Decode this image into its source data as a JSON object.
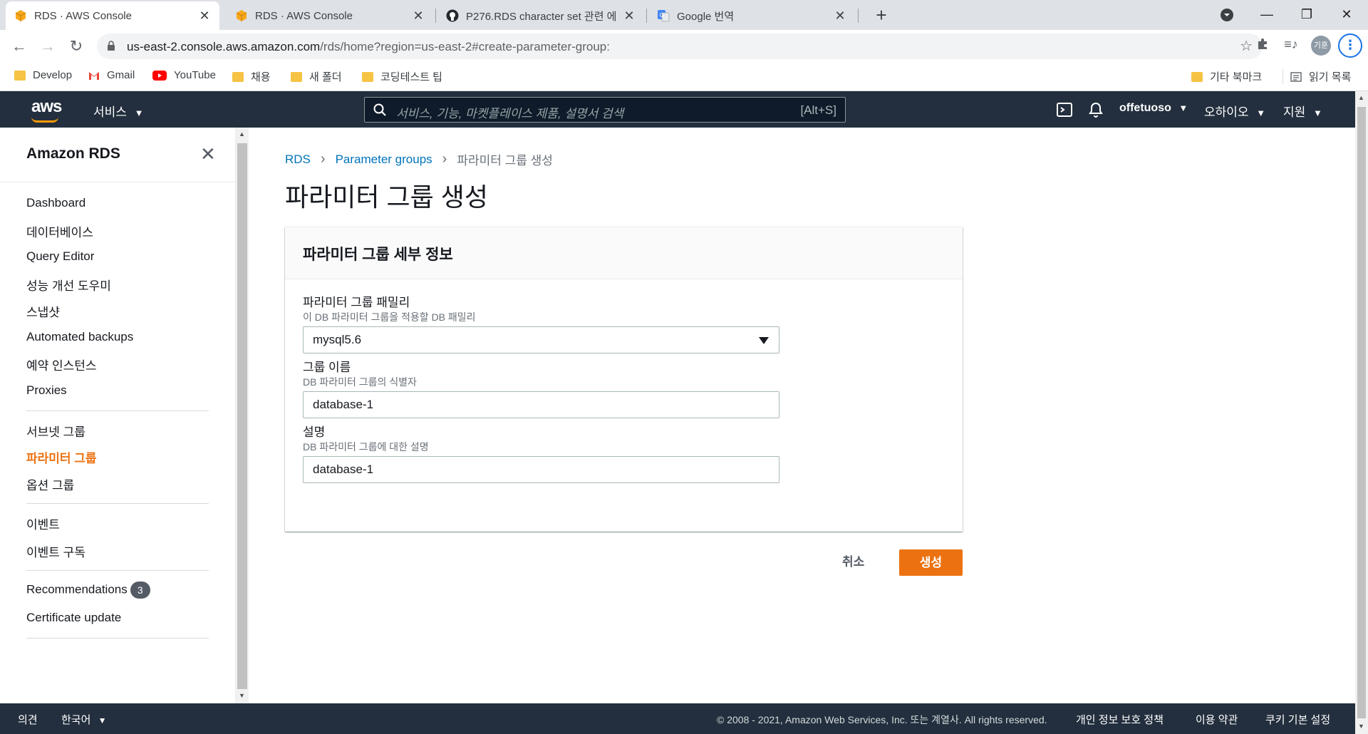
{
  "browser": {
    "tabs": [
      {
        "title": "RDS · AWS Console",
        "active": true,
        "icon": "aws-box-icon"
      },
      {
        "title": "RDS · AWS Console",
        "active": false,
        "icon": "aws-box-icon"
      },
      {
        "title": "P276.RDS character set 관련 에",
        "active": false,
        "icon": "github-icon"
      },
      {
        "title": "Google 번역",
        "active": false,
        "icon": "google-translate-icon"
      }
    ],
    "url_domain": "us-east-2.console.aws.amazon.com",
    "url_path": "/rds/home?region=us-east-2#create-parameter-group:",
    "profile_label": "기훈",
    "bookmarks": [
      {
        "label": "Develop",
        "icon": "folder-icon"
      },
      {
        "label": "Gmail",
        "icon": "gmail-icon"
      },
      {
        "label": "YouTube",
        "icon": "youtube-icon"
      },
      {
        "label": "채용",
        "icon": "folder-icon"
      },
      {
        "label": "새 폴더",
        "icon": "folder-icon"
      },
      {
        "label": "코딩테스트 팁",
        "icon": "folder-icon"
      }
    ],
    "other_bookmarks": "기타 북마크",
    "reading_list": "읽기 목록"
  },
  "aws_nav": {
    "logo": "aws",
    "services": "서비스",
    "search_placeholder": "서비스, 기능, 마켓플레이스 제품, 설명서 검색",
    "search_shortcut": "[Alt+S]",
    "user": "offetuoso",
    "region": "오하이오",
    "support": "지원"
  },
  "sidebar": {
    "title": "Amazon RDS",
    "group1": [
      "Dashboard",
      "데이터베이스",
      "Query Editor",
      "성능 개선 도우미",
      "스냅샷",
      "Automated backups",
      "예약 인스턴스",
      "Proxies"
    ],
    "group2": [
      "서브넷 그룹",
      "파라미터 그룹",
      "옵션 그룹"
    ],
    "group3": [
      "이벤트",
      "이벤트 구독"
    ],
    "recommendations": "Recommendations",
    "recommendations_count": "3",
    "certificate": "Certificate update",
    "active_item": "파라미터 그룹"
  },
  "breadcrumb": {
    "root": "RDS",
    "parent": "Parameter groups",
    "current": "파라미터 그룹 생성"
  },
  "page_title": "파라미터 그룹 생성",
  "panel": {
    "title": "파라미터 그룹 세부 정보",
    "family_label": "파라미터 그룹 패밀리",
    "family_desc": "이 DB 파라미터 그룹을 적용할 DB 패밀리",
    "family_value": "mysql5.6",
    "name_label": "그룹 이름",
    "name_desc": "DB 파라미터 그룹의 식별자",
    "name_value": "database-1",
    "desc_label": "설명",
    "desc_desc": "DB 파라미터 그룹에 대한 설명",
    "desc_value": "database-1"
  },
  "actions": {
    "cancel": "취소",
    "create": "생성"
  },
  "footer": {
    "feedback": "의견",
    "language": "한국어",
    "copyright": "© 2008 - 2021, Amazon Web Services, Inc. 또는 계열사. All rights reserved.",
    "privacy": "개인 정보 보호 정책",
    "terms": "이용 약관",
    "cookies": "쿠키 기본 설정"
  },
  "colors": {
    "aws_nav_bg": "#232f3e",
    "accent_orange": "#ec7211",
    "link_blue": "#0073bb"
  }
}
